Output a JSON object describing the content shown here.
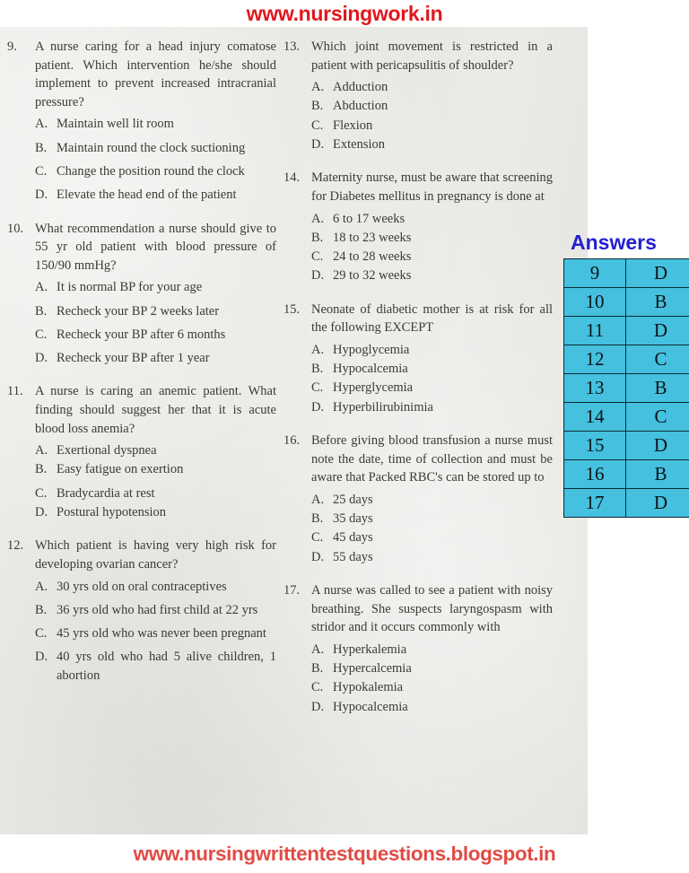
{
  "header": {
    "site_url": "www.nursingwork.in",
    "color": "#e0181d"
  },
  "footer": {
    "site_url": "www.nursingwrittentestquestions.blogspot.in",
    "color": "#e24b45"
  },
  "answers_panel": {
    "title": "Answers",
    "title_color": "#2420cf",
    "cell_color": "#45c0de",
    "rows": [
      {
        "number": "9",
        "answer": "D"
      },
      {
        "number": "10",
        "answer": "B"
      },
      {
        "number": "11",
        "answer": "D"
      },
      {
        "number": "12",
        "answer": "C"
      },
      {
        "number": "13",
        "answer": "B"
      },
      {
        "number": "14",
        "answer": "C"
      },
      {
        "number": "15",
        "answer": "D"
      },
      {
        "number": "16",
        "answer": "B"
      },
      {
        "number": "17",
        "answer": "D"
      }
    ]
  },
  "left_column": [
    {
      "number": "9.",
      "stem": "A nurse caring for a head injury comatose patient. Which intervention he/she should implement to prevent increased intracranial pressure?",
      "options": [
        {
          "letter": "A.",
          "text": "Maintain well lit room"
        },
        {
          "letter": "B.",
          "text": "Maintain round the clock suctioning"
        },
        {
          "letter": "C.",
          "text": "Change the position round the clock"
        },
        {
          "letter": "D.",
          "text": "Elevate the head end of the patient"
        }
      ]
    },
    {
      "number": "10.",
      "stem": "What recommendation a nurse should give to 55 yr old patient with blood pressure of 150/90 mmHg?",
      "options": [
        {
          "letter": "A.",
          "text": "It is normal BP for your age"
        },
        {
          "letter": "B.",
          "text": "Recheck your BP 2 weeks later"
        },
        {
          "letter": "C.",
          "text": "Recheck your BP after 6 months"
        },
        {
          "letter": "D.",
          "text": "Recheck your BP after 1 year"
        }
      ]
    },
    {
      "number": "11.",
      "stem": "A nurse is caring an anemic patient. What finding should suggest her that it is acute blood loss anemia?",
      "options": [
        {
          "letter": "A.",
          "text": "Exertional dyspnea"
        },
        {
          "letter": "B.",
          "text": "Easy fatigue on exertion"
        },
        {
          "letter": "C.",
          "text": "Bradycardia at rest"
        },
        {
          "letter": "D.",
          "text": "Postural hypotension"
        }
      ]
    },
    {
      "number": "12.",
      "stem": "Which patient is having very high risk for developing ovarian cancer?",
      "options": [
        {
          "letter": "A.",
          "text": "30 yrs old on oral contraceptives"
        },
        {
          "letter": "B.",
          "text": "36 yrs old who had first child at 22 yrs"
        },
        {
          "letter": "C.",
          "text": "45 yrs old who was never been pregnant"
        },
        {
          "letter": "D.",
          "text": "40 yrs old who had 5 alive children, 1 abortion"
        }
      ]
    }
  ],
  "right_column": [
    {
      "number": "13.",
      "stem": "Which joint movement is restricted in a patient with pericapsulitis of shoulder?",
      "options": [
        {
          "letter": "A.",
          "text": "Adduction"
        },
        {
          "letter": "B.",
          "text": "Abduction"
        },
        {
          "letter": "C.",
          "text": "Flexion"
        },
        {
          "letter": "D.",
          "text": "Extension"
        }
      ]
    },
    {
      "number": "14.",
      "stem": "Maternity nurse, must be aware that screening for Diabetes mellitus in pregnancy is done at",
      "options": [
        {
          "letter": "A.",
          "text": "6 to 17 weeks"
        },
        {
          "letter": "B.",
          "text": "18 to 23 weeks"
        },
        {
          "letter": "C.",
          "text": "24 to 28 weeks"
        },
        {
          "letter": "D.",
          "text": "29 to 32 weeks"
        }
      ]
    },
    {
      "number": "15.",
      "stem": "Neonate of diabetic mother is at risk for all the following EXCEPT",
      "options": [
        {
          "letter": "A.",
          "text": "Hypoglycemia"
        },
        {
          "letter": "B.",
          "text": "Hypocalcemia"
        },
        {
          "letter": "C.",
          "text": "Hyperglycemia"
        },
        {
          "letter": "D.",
          "text": "Hyperbilirubinimia"
        }
      ]
    },
    {
      "number": "16.",
      "stem": "Before giving blood transfusion a nurse must note the date, time of collection and must be aware that Packed RBC's can be stored up to",
      "options": [
        {
          "letter": "A.",
          "text": "25 days"
        },
        {
          "letter": "B.",
          "text": "35 days"
        },
        {
          "letter": "C.",
          "text": "45 days"
        },
        {
          "letter": "D.",
          "text": "55 days"
        }
      ]
    },
    {
      "number": "17.",
      "stem": "A nurse was called to see a patient with noisy breathing. She suspects laryngospasm with stridor and it occurs commonly with",
      "options": [
        {
          "letter": "A.",
          "text": "Hyperkalemia"
        },
        {
          "letter": "B.",
          "text": "Hypercalcemia"
        },
        {
          "letter": "C.",
          "text": "Hypokalemia"
        },
        {
          "letter": "D.",
          "text": "Hypocalcemia"
        }
      ]
    }
  ]
}
